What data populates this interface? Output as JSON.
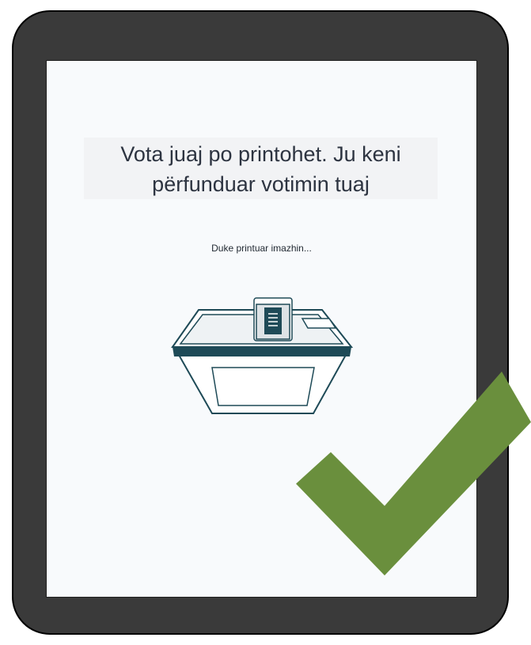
{
  "screen": {
    "title_line_1": "Vota juaj po printohet. Ju keni",
    "title_line_2": "përfunduar votimin tuaj",
    "status": "Duke printuar imazhin..."
  },
  "icons": {
    "illustration": "ballot-printer-icon",
    "overlay": "checkmark-icon"
  },
  "colors": {
    "frame": "#3a3a3a",
    "screen_bg": "#f8fafc",
    "machine_accent": "#1e4a57",
    "checkmark": "#6a8f3d"
  }
}
